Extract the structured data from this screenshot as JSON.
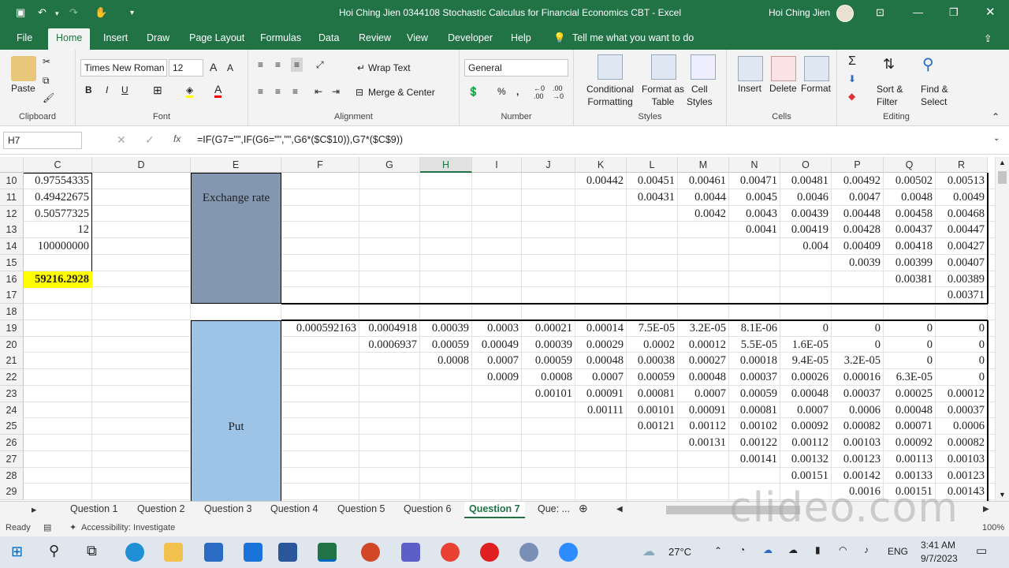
{
  "window": {
    "title": "Hoi Ching Jien 0344108 Stochastic Calculus for Financial Economics CBT  -  Excel",
    "user": "Hoi Ching Jien"
  },
  "tabs": [
    "File",
    "Home",
    "Insert",
    "Draw",
    "Page Layout",
    "Formulas",
    "Data",
    "Review",
    "View",
    "Developer",
    "Help"
  ],
  "tell_me": "Tell me what you want to do",
  "ribbon": {
    "clipboard": {
      "paste": "Paste",
      "label": "Clipboard"
    },
    "font": {
      "name": "Times New Roman",
      "size": "12",
      "label": "Font",
      "bold": "B",
      "italic": "I",
      "underline": "U"
    },
    "alignment": {
      "wrap": "Wrap Text",
      "merge": "Merge & Center",
      "label": "Alignment"
    },
    "number": {
      "format": "General",
      "label": "Number",
      "dec_inc": ".00 →.0",
      "pct": "%",
      "comma": ","
    },
    "styles": {
      "cond1": "Conditional",
      "cond2": "Formatting",
      "fmt1": "Format as",
      "fmt2": "Table",
      "cell1": "Cell",
      "cell2": "Styles",
      "label": "Styles"
    },
    "cells": {
      "insert": "Insert",
      "delete": "Delete",
      "format": "Format",
      "label": "Cells"
    },
    "editing": {
      "sort1": "Sort &",
      "sort2": "Filter",
      "find1": "Find &",
      "find2": "Select",
      "label": "Editing"
    }
  },
  "formula_bar": {
    "name_box": "H7",
    "fx": "fx",
    "formula": "=IF(G7=\"\",IF(G6=\"\",\"\",G6*($C$10)),G7*($C$9))"
  },
  "columns": [
    "C",
    "D",
    "E",
    "F",
    "G",
    "H",
    "I",
    "J",
    "K",
    "L",
    "M",
    "N",
    "O",
    "P",
    "Q",
    "R"
  ],
  "rows": [
    "10",
    "11",
    "12",
    "13",
    "14",
    "15",
    "16",
    "17",
    "18",
    "19",
    "20",
    "21",
    "22",
    "23",
    "24",
    "25",
    "26",
    "27",
    "28",
    "29"
  ],
  "c_values": {
    "10": "0.97554335",
    "11": "0.49422675",
    "12": "0.50577325",
    "13": "12",
    "14": "100000000",
    "16": "59216.2928"
  },
  "labels": {
    "exchange": "Exchange rate",
    "put": "Put"
  },
  "upper": {
    "10": [
      "",
      "",
      "",
      "",
      "",
      "0.00442",
      "0.00451",
      "0.00461",
      "0.00471",
      "0.00481",
      "0.00492",
      "0.00502",
      "0.00513"
    ],
    "11": [
      "",
      "",
      "",
      "",
      "",
      "",
      "0.00431",
      "0.0044",
      "0.0045",
      "0.0046",
      "0.0047",
      "0.0048",
      "0.0049"
    ],
    "12": [
      "",
      "",
      "",
      "",
      "",
      "",
      "",
      "0.0042",
      "0.0043",
      "0.00439",
      "0.00448",
      "0.00458",
      "0.00468"
    ],
    "13": [
      "",
      "",
      "",
      "",
      "",
      "",
      "",
      "",
      "0.0041",
      "0.00419",
      "0.00428",
      "0.00437",
      "0.00447"
    ],
    "14": [
      "",
      "",
      "",
      "",
      "",
      "",
      "",
      "",
      "",
      "0.004",
      "0.00409",
      "0.00418",
      "0.00427"
    ],
    "15": [
      "",
      "",
      "",
      "",
      "",
      "",
      "",
      "",
      "",
      "",
      "0.0039",
      "0.00399",
      "0.00407"
    ],
    "16": [
      "",
      "",
      "",
      "",
      "",
      "",
      "",
      "",
      "",
      "",
      "",
      "0.00381",
      "0.00389"
    ],
    "17": [
      "",
      "",
      "",
      "",
      "",
      "",
      "",
      "",
      "",
      "",
      "",
      "",
      "0.00371"
    ]
  },
  "put": {
    "19": [
      "0.000592163",
      "0.0004918",
      "0.00039",
      "0.0003",
      "0.00021",
      "0.00014",
      "7.5E-05",
      "3.2E-05",
      "8.1E-06",
      "0",
      "0",
      "0",
      "0"
    ],
    "20": [
      "",
      "0.0006937",
      "0.00059",
      "0.00049",
      "0.00039",
      "0.00029",
      "0.0002",
      "0.00012",
      "5.5E-05",
      "1.6E-05",
      "0",
      "0",
      "0"
    ],
    "21": [
      "",
      "",
      "0.0008",
      "0.0007",
      "0.00059",
      "0.00048",
      "0.00038",
      "0.00027",
      "0.00018",
      "9.4E-05",
      "3.2E-05",
      "0",
      "0"
    ],
    "22": [
      "",
      "",
      "",
      "0.0009",
      "0.0008",
      "0.0007",
      "0.00059",
      "0.00048",
      "0.00037",
      "0.00026",
      "0.00016",
      "6.3E-05",
      "0"
    ],
    "23": [
      "",
      "",
      "",
      "",
      "0.00101",
      "0.00091",
      "0.00081",
      "0.0007",
      "0.00059",
      "0.00048",
      "0.00037",
      "0.00025",
      "0.00012"
    ],
    "24": [
      "",
      "",
      "",
      "",
      "",
      "0.00111",
      "0.00101",
      "0.00091",
      "0.00081",
      "0.0007",
      "0.0006",
      "0.00048",
      "0.00037"
    ],
    "25": [
      "",
      "",
      "",
      "",
      "",
      "",
      "0.00121",
      "0.00112",
      "0.00102",
      "0.00092",
      "0.00082",
      "0.00071",
      "0.0006"
    ],
    "26": [
      "",
      "",
      "",
      "",
      "",
      "",
      "",
      "0.00131",
      "0.00122",
      "0.00112",
      "0.00103",
      "0.00092",
      "0.00082"
    ],
    "27": [
      "",
      "",
      "",
      "",
      "",
      "",
      "",
      "",
      "0.00141",
      "0.00132",
      "0.00123",
      "0.00113",
      "0.00103"
    ],
    "28": [
      "",
      "",
      "",
      "",
      "",
      "",
      "",
      "",
      "",
      "0.00151",
      "0.00142",
      "0.00133",
      "0.00123"
    ],
    "29": [
      "",
      "",
      "",
      "",
      "",
      "",
      "",
      "",
      "",
      "",
      "0.0016",
      "0.00151",
      "0.00143"
    ]
  },
  "sheets": [
    "Question 1",
    "Question 2",
    "Question 3",
    "Question 4",
    "Question 5",
    "Question 6",
    "Question 7",
    "Que: ..."
  ],
  "status": {
    "ready": "Ready",
    "accessibility": "Accessibility: Investigate",
    "zoom": "100%"
  },
  "taskbar": {
    "temp": "27°C",
    "lang": "ENG",
    "time": "3:41 AM",
    "date": "9/7/2023"
  },
  "watermark": "clideo.com",
  "colors": {
    "excel_green": "#217346",
    "exchange_fill": "#8497b0",
    "put_fill": "#9dc3e6",
    "highlight": "#ffff00"
  }
}
